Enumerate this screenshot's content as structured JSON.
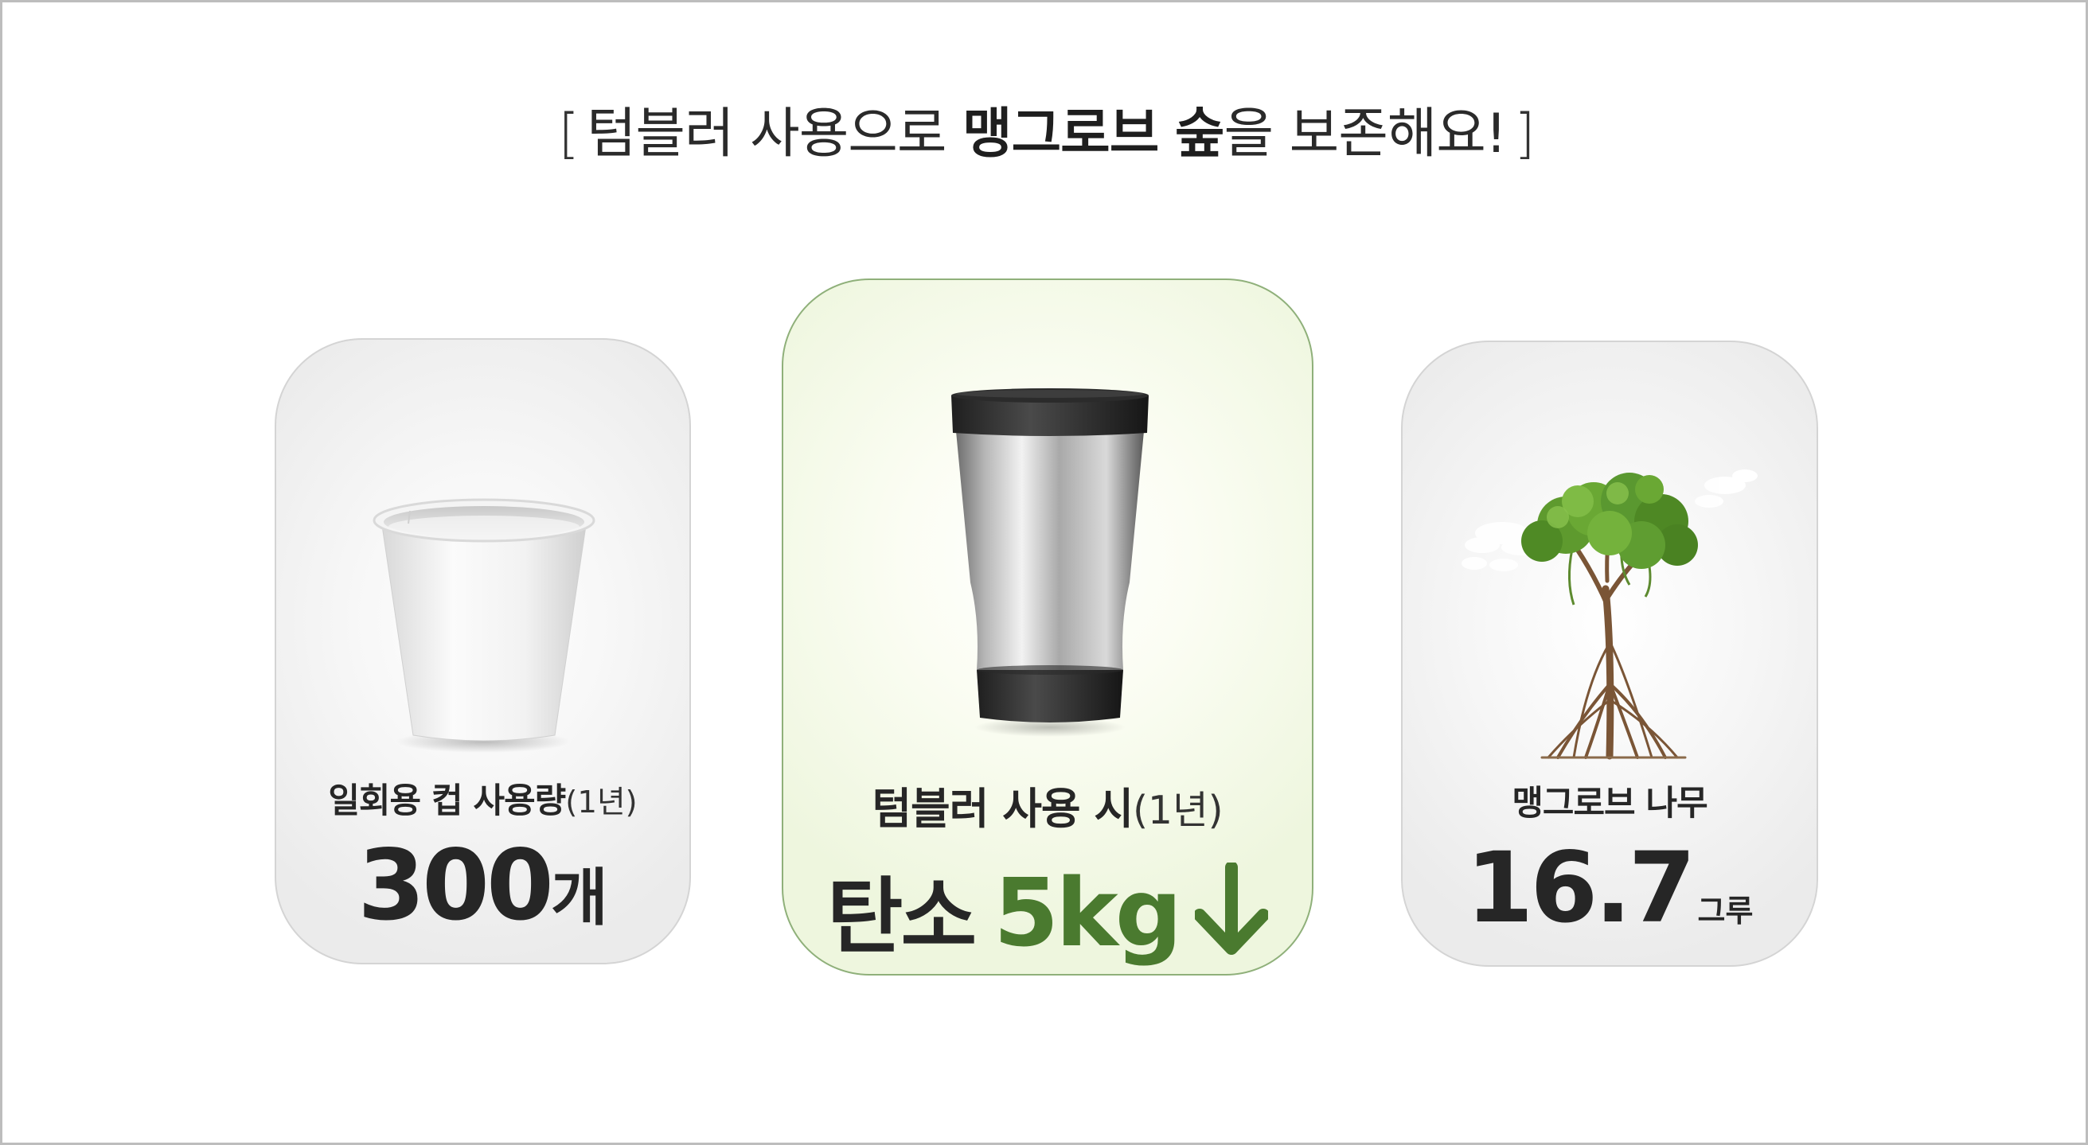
{
  "headline": {
    "open_bracket": "[",
    "part1": "텀블러 사용으로 ",
    "highlight1": "맹그로브",
    "space": " ",
    "highlight2": "숲",
    "part2": "을 보존해요!",
    "close_bracket": "]"
  },
  "cards": [
    {
      "id": "disposable-cup",
      "icon": "paper-cup-icon",
      "label_main": "일회용 컵 사용량",
      "label_sub": "(1년)",
      "value": "300",
      "unit": "개"
    },
    {
      "id": "tumbler",
      "icon": "tumbler-icon",
      "label_main": "텀블러 사용 시",
      "label_sub": "(1년)",
      "value_prefix": "탄소",
      "value": "5kg",
      "indicator": "arrow-down-icon",
      "accent_color": "#4a7a2f"
    },
    {
      "id": "mangrove",
      "icon": "mangrove-tree-icon",
      "label_main": "맹그로브 나무",
      "value": "16.7",
      "unit": "그루"
    }
  ],
  "colors": {
    "accent_green": "#4a7a2f",
    "highlight_card_bg": "#eef6de",
    "highlight_card_border": "#8fb07a",
    "neutral_card_bg": "#ebebeb",
    "text_dark": "#262626"
  }
}
